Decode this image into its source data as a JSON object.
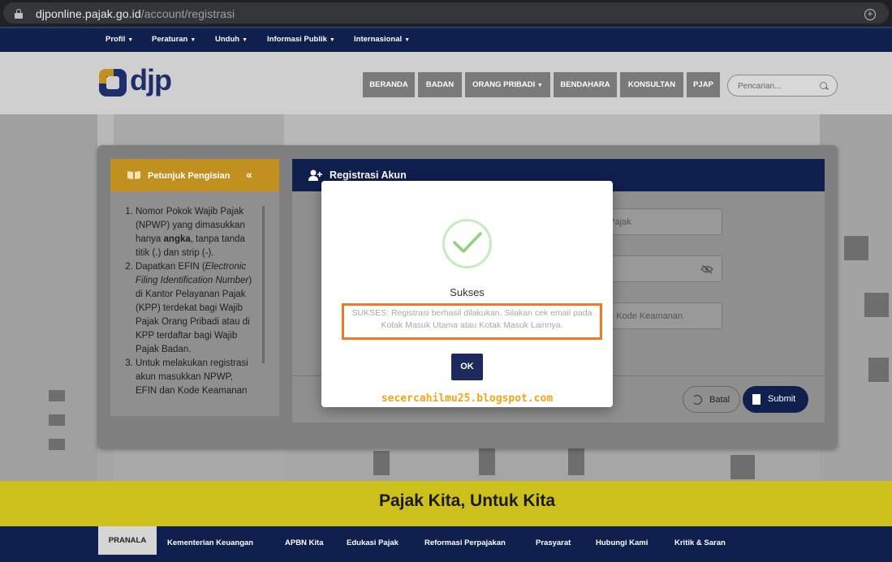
{
  "browser": {
    "url_domain": "djponline.pajak.go.id",
    "url_path": "/account/registrasi"
  },
  "top_nav": {
    "items": [
      "Profil",
      "Peraturan",
      "Unduh",
      "Informasi Publik",
      "Internasional"
    ]
  },
  "logo": {
    "text": "djp"
  },
  "main_menu": {
    "items": [
      "BERANDA",
      "BADAN",
      "ORANG PRIBADI",
      "BENDAHARA",
      "KONSULTAN",
      "PJAP"
    ],
    "search_placeholder": "Pencarian..."
  },
  "sidebar": {
    "title": "Petunjuk Pengisian",
    "collapse_glyph": "«",
    "instructions": [
      {
        "parts": [
          {
            "t": "Nomor Pokok Wajib Pajak (NPWP) yang dimasukkan hanya "
          },
          {
            "t": "angka",
            "b": true
          },
          {
            "t": ", tanpa tanda titik (.) dan strip (-)."
          }
        ]
      },
      {
        "parts": [
          {
            "t": "Dapatkan EFIN ("
          },
          {
            "t": "Electronic Filing Identification Number",
            "i": true
          },
          {
            "t": ") di Kantor Pelayanan Pajak (KPP) terdekat bagi Wajib Pajak Orang Pribadi atau di KPP terdaftar bagi Wajib Pajak Badan."
          }
        ]
      },
      {
        "parts": [
          {
            "t": "Untuk melakukan registrasi akun masukkan NPWP, EFIN dan Kode Keamanan"
          }
        ]
      }
    ]
  },
  "registration": {
    "title": "Registrasi Akun",
    "field_npwp_placeholder_visible": "b Pajak",
    "field_kode_placeholder_visible": "n Kode Keamanan",
    "cancel_label": "Batal",
    "submit_label": "Submit"
  },
  "modal": {
    "title": "Sukses",
    "message": "SUKSES: Registrasi berhasil dilakukan. Silakan cek email pada Kotak Masuk Utama atau Kotak Masuk Lainnya.",
    "ok_label": "OK",
    "watermark": "secercahilmu25.blogspot.com"
  },
  "banner": {
    "tagline": "Pajak Kita, Untuk Kita"
  },
  "footer_nav": {
    "active_label": "PRANALA",
    "items": [
      "Kementerian Keuangan",
      "APBN Kita",
      "Edukasi Pajak",
      "Reformasi Perpajakan",
      "Prasyarat",
      "Hubungi Kami",
      "Kritik & Saran"
    ]
  },
  "colors": {
    "navy": "#0f1f4e",
    "gold": "#c2901e",
    "banner_yellow": "#cdc01c",
    "highlight_orange": "#f07a22",
    "success_green": "#8fd17f"
  }
}
